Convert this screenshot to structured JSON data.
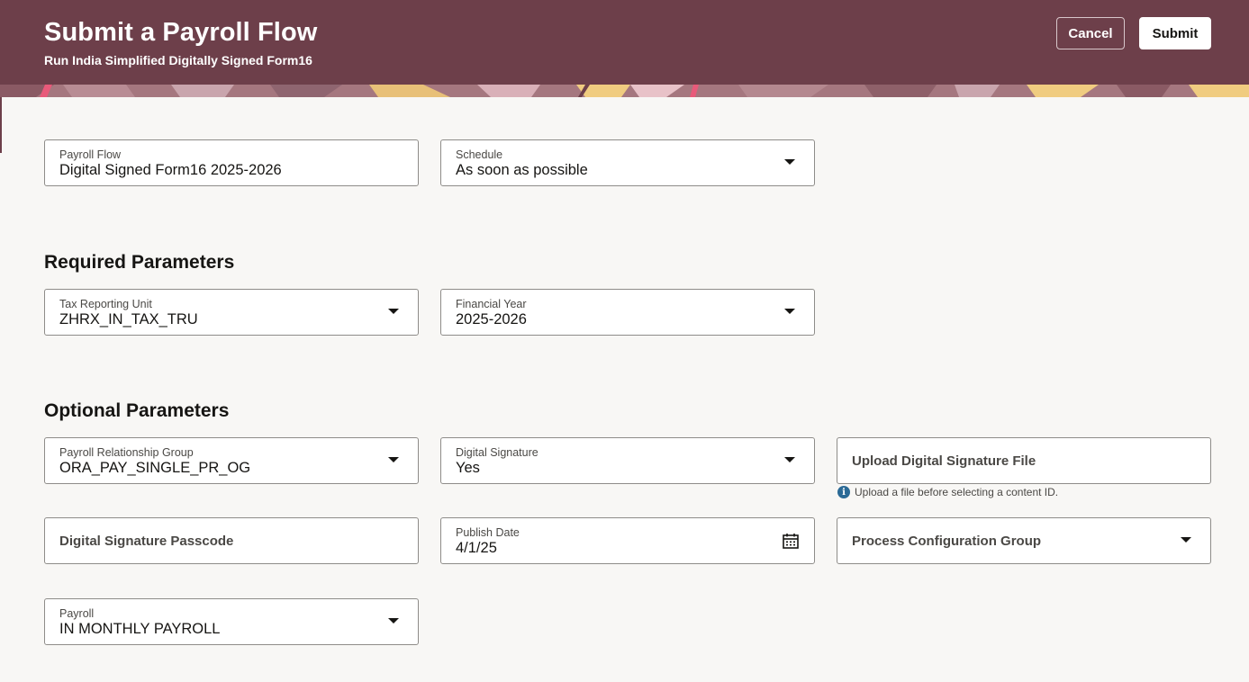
{
  "header": {
    "title": "Submit a Payroll Flow",
    "subtitle": "Run India Simplified Digitally Signed Form16",
    "cancel_label": "Cancel",
    "submit_label": "Submit"
  },
  "flow": {
    "payroll_flow": {
      "label": "Payroll Flow",
      "value": "Digital Signed Form16 2025-2026"
    },
    "schedule": {
      "label": "Schedule",
      "value": "As soon as possible"
    }
  },
  "required": {
    "title": "Required Parameters",
    "tax_reporting_unit": {
      "label": "Tax Reporting Unit",
      "value": "ZHRX_IN_TAX_TRU"
    },
    "financial_year": {
      "label": "Financial Year",
      "value": "2025-2026"
    }
  },
  "optional": {
    "title": "Optional Parameters",
    "payroll_relationship_group": {
      "label": "Payroll Relationship Group",
      "value": "ORA_PAY_SINGLE_PR_OG"
    },
    "digital_signature": {
      "label": "Digital Signature",
      "value": "Yes"
    },
    "upload_file": {
      "placeholder": "Upload Digital Signature File",
      "hint": "Upload a file before selecting a content ID."
    },
    "passcode": {
      "placeholder": "Digital Signature Passcode"
    },
    "publish_date": {
      "label": "Publish Date",
      "value": "4/1/25"
    },
    "process_config_group": {
      "placeholder": "Process Configuration Group"
    },
    "payroll": {
      "label": "Payroll",
      "value": "IN MONTHLY PAYROLL"
    }
  },
  "icons": {
    "dropdown": "chevron-down-icon",
    "calendar": "calendar-icon",
    "info": "info-icon"
  },
  "colors": {
    "header_bg": "#6d3f4a",
    "page_bg": "#f8f7f5",
    "info_blue": "#2b6a96"
  }
}
